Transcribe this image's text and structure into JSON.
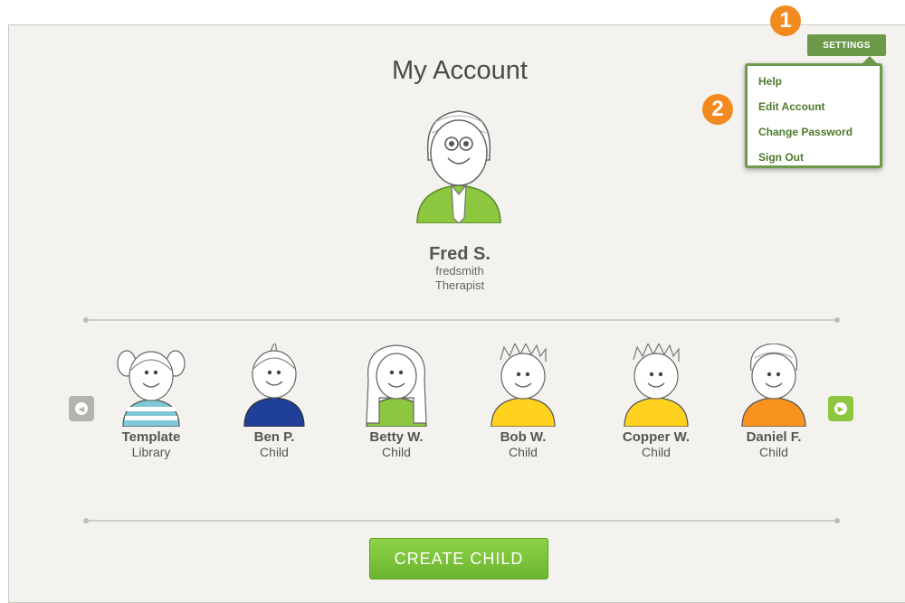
{
  "page": {
    "title": "My Account"
  },
  "user": {
    "name": "Fred S.",
    "username": "fredsmith",
    "role": "Therapist"
  },
  "children": [
    {
      "name": "Template",
      "role": "Library"
    },
    {
      "name": "Ben P.",
      "role": "Child"
    },
    {
      "name": "Betty W.",
      "role": "Child"
    },
    {
      "name": "Bob W.",
      "role": "Child"
    },
    {
      "name": "Copper W.",
      "role": "Child"
    },
    {
      "name": "Daniel F.",
      "role": "Child"
    }
  ],
  "actions": {
    "create_child": "CREATE CHILD"
  },
  "settings": {
    "label": "SETTINGS",
    "menu": [
      "Help",
      "Edit Account",
      "Change Password",
      "Sign Out"
    ]
  },
  "callouts": [
    "1",
    "2"
  ],
  "colors": {
    "accent_green": "#8dc63f",
    "settings_green": "#6d9a4a",
    "callout_orange": "#f28a1f",
    "nav_prev": "#b3b3b0",
    "nav_next": "#8dc63f"
  },
  "icons": {
    "prev": "chevron-left-icon",
    "next": "chevron-right-icon"
  }
}
